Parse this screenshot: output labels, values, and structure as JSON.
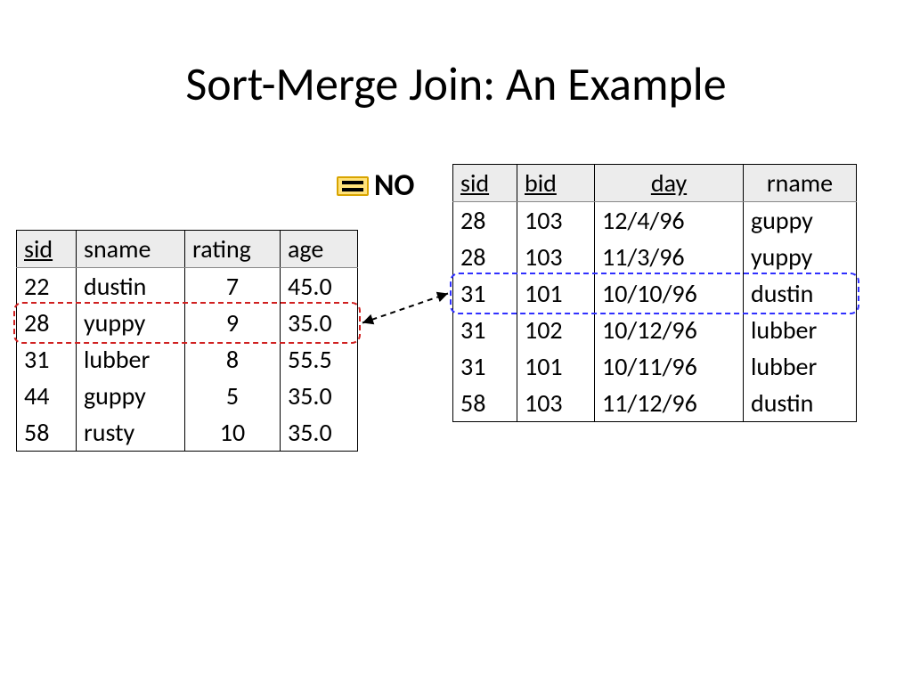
{
  "title": "Sort-Merge Join: An Example",
  "compare_label": "NO",
  "left_table": {
    "headers": [
      "sid",
      "sname",
      "rating",
      "age"
    ],
    "header_underline": [
      true,
      false,
      false,
      false
    ],
    "rows": [
      [
        "22",
        "dustin",
        "7",
        "45.0"
      ],
      [
        "28",
        "yuppy",
        "9",
        "35.0"
      ],
      [
        "31",
        "lubber",
        "8",
        "55.5"
      ],
      [
        "44",
        "guppy",
        "5",
        "35.0"
      ],
      [
        "58",
        "rusty",
        "10",
        "35.0"
      ]
    ]
  },
  "right_table": {
    "headers": [
      "sid",
      "bid",
      "day",
      "rname"
    ],
    "header_underline": [
      true,
      true,
      true,
      false
    ],
    "rows": [
      [
        "28",
        "103",
        "12/4/96",
        "guppy"
      ],
      [
        "28",
        "103",
        "11/3/96",
        "yuppy"
      ],
      [
        "31",
        "101",
        "10/10/96",
        "dustin"
      ],
      [
        "31",
        "102",
        "10/12/96",
        "lubber"
      ],
      [
        "31",
        "101",
        "10/11/96",
        "lubber"
      ],
      [
        "58",
        "103",
        "11/12/96",
        "dustin"
      ]
    ]
  },
  "highlight": {
    "left_row_index": 1,
    "right_row_index": 2,
    "match": false
  }
}
